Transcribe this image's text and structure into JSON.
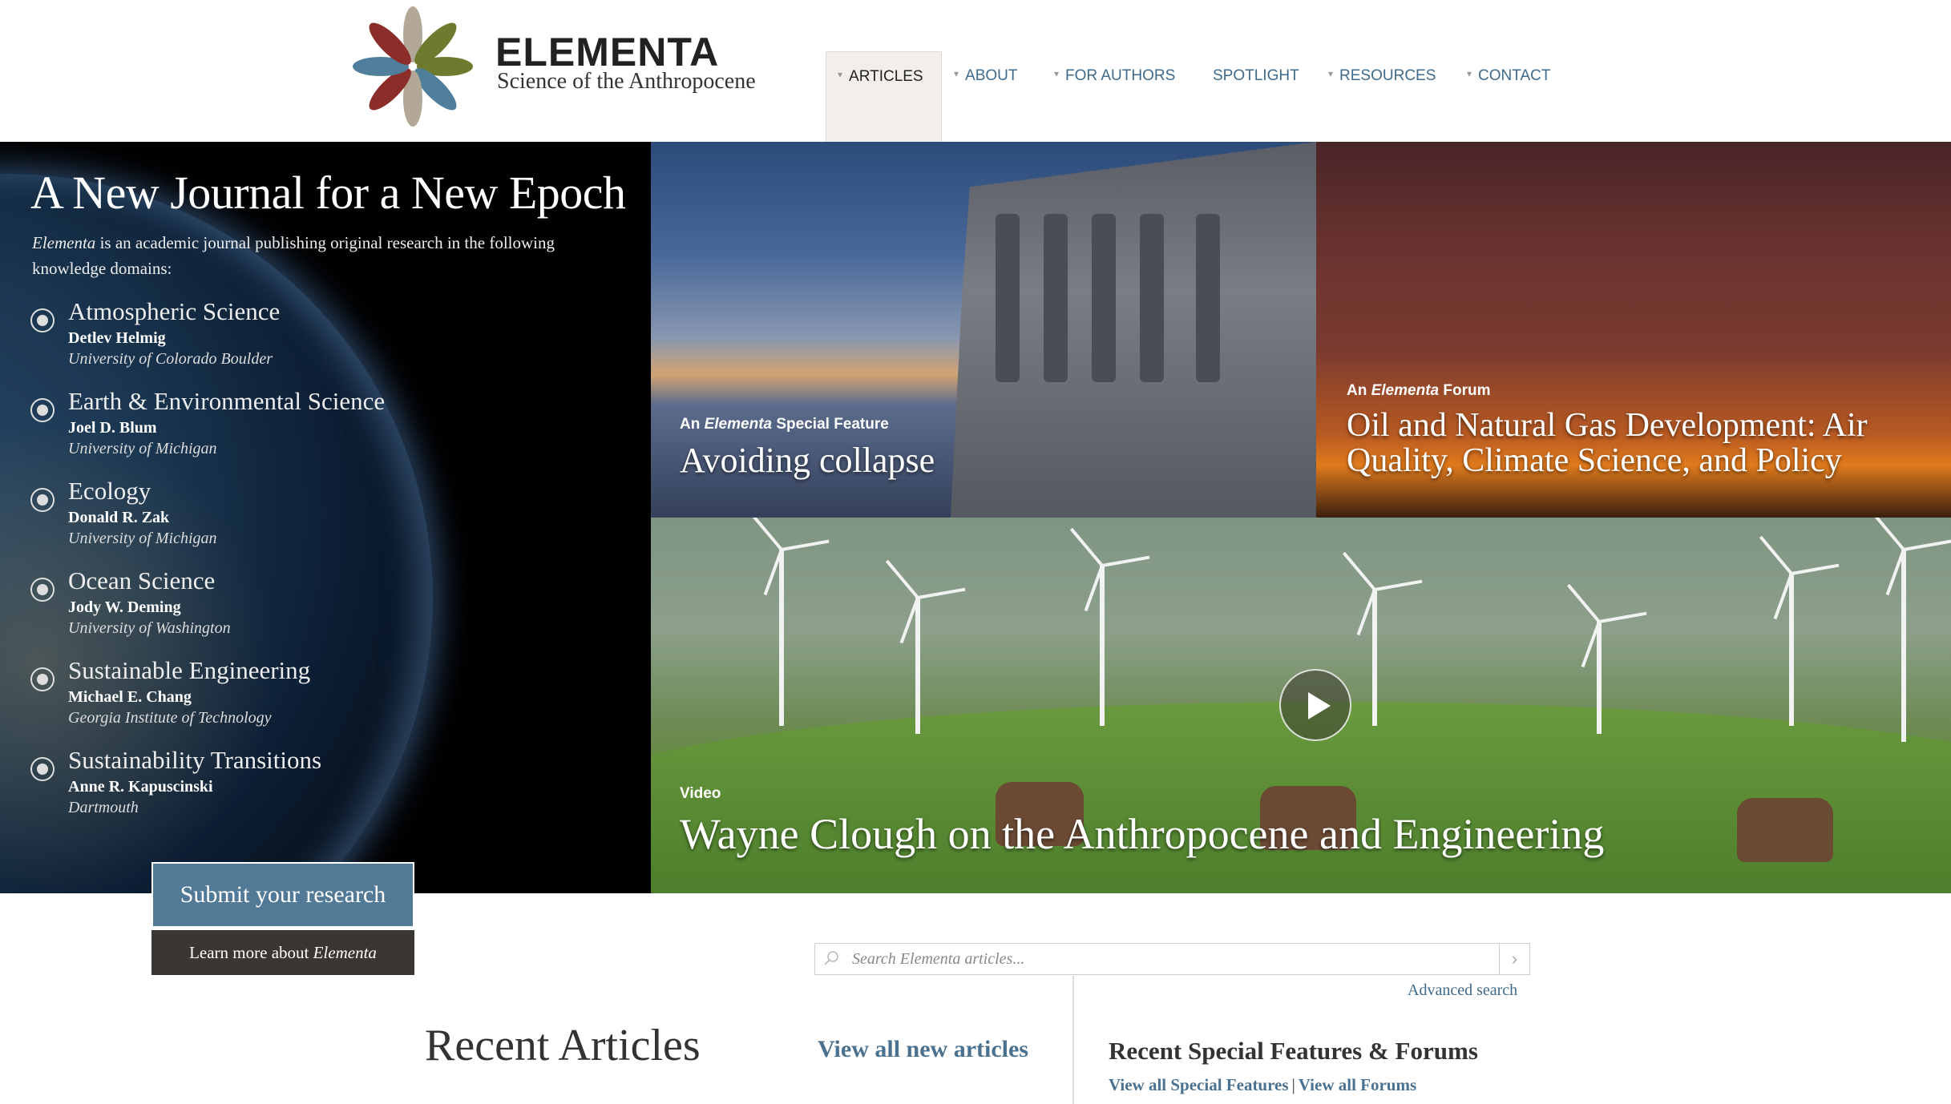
{
  "header": {
    "brand_name": "ELEMENTA",
    "brand_tagline": "Science of the Anthropocene",
    "nav": [
      {
        "label": "ARTICLES",
        "active": true,
        "has_menu": true
      },
      {
        "label": "ABOUT",
        "active": false,
        "has_menu": true
      },
      {
        "label": "FOR AUTHORS",
        "active": false,
        "has_menu": true
      },
      {
        "label": "SPOTLIGHT",
        "active": false,
        "has_menu": false
      },
      {
        "label": "RESOURCES",
        "active": false,
        "has_menu": true
      },
      {
        "label": "CONTACT",
        "active": false,
        "has_menu": true
      }
    ]
  },
  "intro": {
    "title": "A New Journal for a New Epoch",
    "text_em": "Elementa",
    "text_rest": " is an academic journal publishing original research in the following knowledge domains:"
  },
  "domains": [
    {
      "name": "Atmospheric Science",
      "editor": "Detlev Helmig",
      "institution": "University of Colorado Boulder",
      "icon": "atmosphere-icon"
    },
    {
      "name": "Earth & Environmental Science",
      "editor": "Joel D. Blum",
      "institution": "University of Michigan",
      "icon": "globe-icon"
    },
    {
      "name": "Ecology",
      "editor": "Donald R. Zak",
      "institution": "University of Michigan",
      "icon": "leaf-icon"
    },
    {
      "name": "Ocean Science",
      "editor": "Jody W. Deming",
      "institution": "University of Washington",
      "icon": "wave-icon"
    },
    {
      "name": "Sustainable Engineering",
      "editor": "Michael E. Chang",
      "institution": "Georgia Institute of Technology",
      "icon": "gears-icon"
    },
    {
      "name": "Sustainability Transitions",
      "editor": "Anne R. Kapuscinski",
      "institution": "Dartmouth",
      "icon": "cycle-icon"
    }
  ],
  "buttons": {
    "submit": "Submit your research",
    "learn_prefix": "Learn more about ",
    "learn_em": "Elementa"
  },
  "features": {
    "acropolis": {
      "label_prefix": "An ",
      "label_em": "Elementa",
      "label_suffix": " Special Feature",
      "title": "Avoiding collapse"
    },
    "oil": {
      "label_prefix": "An ",
      "label_em": "Elementa",
      "label_suffix": " Forum",
      "title_line1": "Oil and Natural Gas Development: Air",
      "title_line2": "Quality, Climate Science, and Policy"
    },
    "video": {
      "label": "Video",
      "title": "Wayne Clough on the Anthropocene and Engineering"
    }
  },
  "search": {
    "placeholder": "Search Elementa articles...",
    "go": "›",
    "advanced": "Advanced search"
  },
  "recent": {
    "title": "Recent Articles",
    "view_all": "View all new articles"
  },
  "special": {
    "title": "Recent Special Features & Forums",
    "link_features": "View all Special Features",
    "separator": "|",
    "link_forums": "View all Forums"
  },
  "colors": {
    "accent_blue": "#527a96",
    "link_blue": "#4a7290",
    "dark_button": "#3a3632",
    "logo_blue": "#4f7f9b",
    "logo_olive": "#6e7b2e",
    "logo_red": "#8b2e2a",
    "logo_tan": "#b3a897"
  }
}
